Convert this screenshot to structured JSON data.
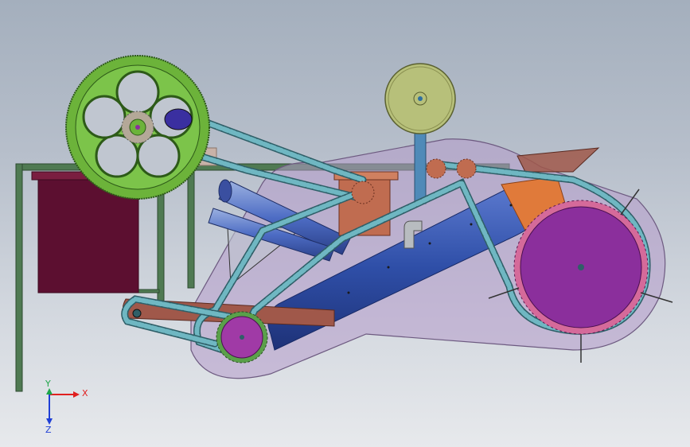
{
  "viewport": {
    "background_top": "#a4afbd",
    "background_bottom": "#e7e9ec"
  },
  "triad": {
    "x_label": "X",
    "y_label": "Y",
    "z_label": "Z",
    "x_color": "#e01f1f",
    "y_color": "#1fa64a",
    "z_color": "#1f3fd6"
  },
  "components": {
    "flywheel": {
      "color": "#6cb33a"
    },
    "top_pulley": {
      "color": "#b7c07a"
    },
    "big_sprocket": {
      "color": "#8b2f9c"
    },
    "small_sprocket": {
      "color": "#a03aa6"
    },
    "motor_box": {
      "color": "#5c0f30"
    },
    "frame": {
      "color": "#4f7a52"
    },
    "housing": {
      "color": "#b49acb"
    },
    "chain": {
      "color": "#6fb7c2"
    },
    "cylinder": {
      "color": "#2f4fa8"
    }
  }
}
